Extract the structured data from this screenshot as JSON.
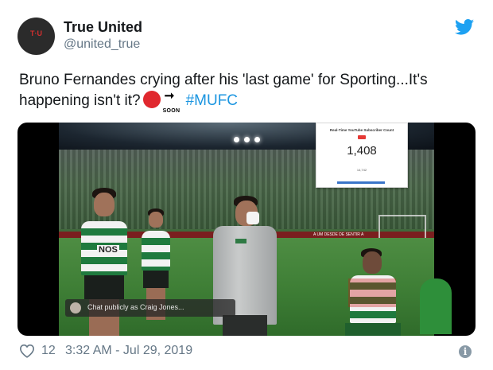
{
  "author": {
    "name": "True United",
    "handle": "@united_true",
    "avatar_text": "T·U"
  },
  "tweet": {
    "text_main": "Bruno Fernandes crying after his 'last game' for Sporting...It's happening isn't it?",
    "soon_label": "SOON",
    "hashtag": "#MUFC"
  },
  "media": {
    "subscriber_card": {
      "title": "Real-Time YouTube Subscriber Count",
      "count": "1,408",
      "sub": "14,742"
    },
    "chat_placeholder": "Chat publicly as Craig Jones...",
    "sponsor_text": "NOS",
    "ad_text": "A UM DESDE DE SENTIR A"
  },
  "footer": {
    "likes": "12",
    "timestamp": "3:32 AM - Jul 29, 2019"
  },
  "icons": {
    "twitter": "twitter-bird-icon",
    "like": "heart-icon",
    "info": "info-icon"
  },
  "colors": {
    "accent": "#1b95e0",
    "text": "#14171a",
    "muted": "#657786",
    "record_dot": "#e0282e"
  }
}
